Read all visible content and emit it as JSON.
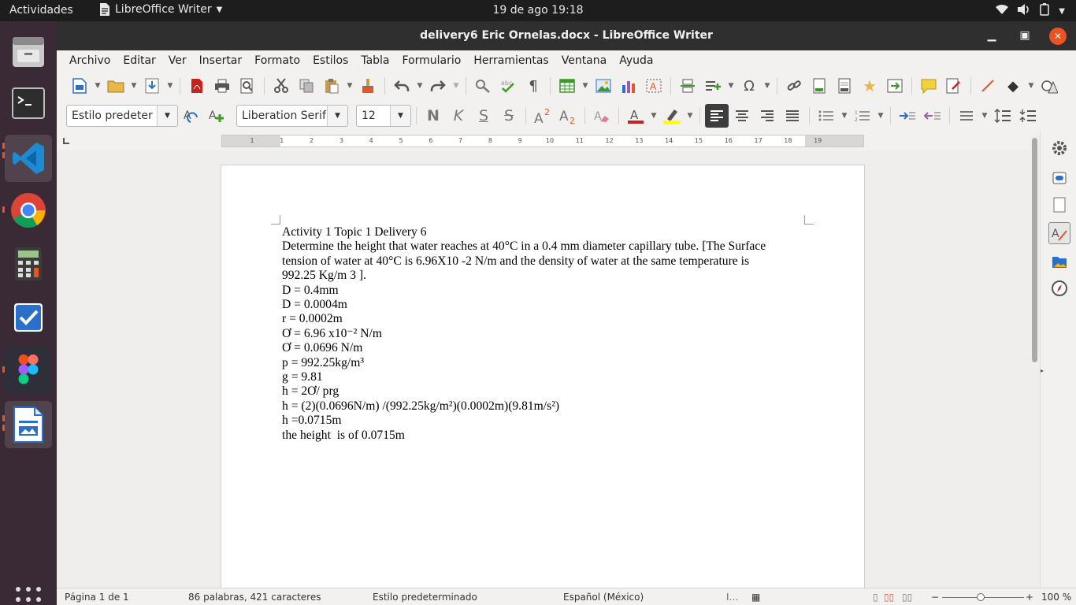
{
  "topbar": {
    "activities": "Actividades",
    "app_name": "LibreOffice Writer",
    "clock": "19 de ago  19:18"
  },
  "window": {
    "title": "delivery6 Eric Ornelas.docx - LibreOffice Writer"
  },
  "menu": [
    "Archivo",
    "Editar",
    "Ver",
    "Insertar",
    "Formato",
    "Estilos",
    "Tabla",
    "Formulario",
    "Herramientas",
    "Ventana",
    "Ayuda"
  ],
  "formatting": {
    "paragraph_style": "Estilo predeter",
    "font_name": "Liberation Serif",
    "font_size": "12",
    "bold": "N",
    "italic": "K",
    "underline": "S",
    "strike": "S"
  },
  "ruler": {
    "numbers": [
      "1",
      "1",
      "2",
      "3",
      "4",
      "5",
      "6",
      "7",
      "8",
      "9",
      "10",
      "11",
      "12",
      "13",
      "14",
      "15",
      "16",
      "17",
      "18",
      "19"
    ]
  },
  "document": {
    "lines": [
      "Activity 1 Topic 1 Delivery 6",
      "Determine the height that water reaches at 40°C in a 0.4 mm diameter capillary tube. [The Surface",
      "tension of water at 40°C is 6.96X10 -2 N/m and the density of water at the same temperature is",
      "992.25 Kg/m 3 ].",
      "D = 0.4mm",
      "D = 0.0004m",
      "r = 0.0002m",
      "Ơ = 6.96 x10⁻² N/m",
      "Ơ = 0.0696 N/m",
      "p = 992.25kg/m³",
      "g = 9.81",
      "h = 2Ơ/ prg",
      "h = (2)(0.0696N/m) /(992.25kg/m²)(0.0002m)(9.81m/s²)",
      "h =0.0715m",
      "the height  is of 0.0715m"
    ]
  },
  "statusbar": {
    "page": "Página 1 de 1",
    "words": "86 palabras, 421 caracteres",
    "style": "Estilo predeterminado",
    "language": "Español (México)",
    "zoom": "100 %",
    "zoom_level": 100
  },
  "colors": {
    "titlebar": "#2f2f2f",
    "dock": "#3a2a36",
    "accent": "#e95420",
    "font_color_bar": "#c9211e",
    "highlight_bar": "#ffff00"
  }
}
